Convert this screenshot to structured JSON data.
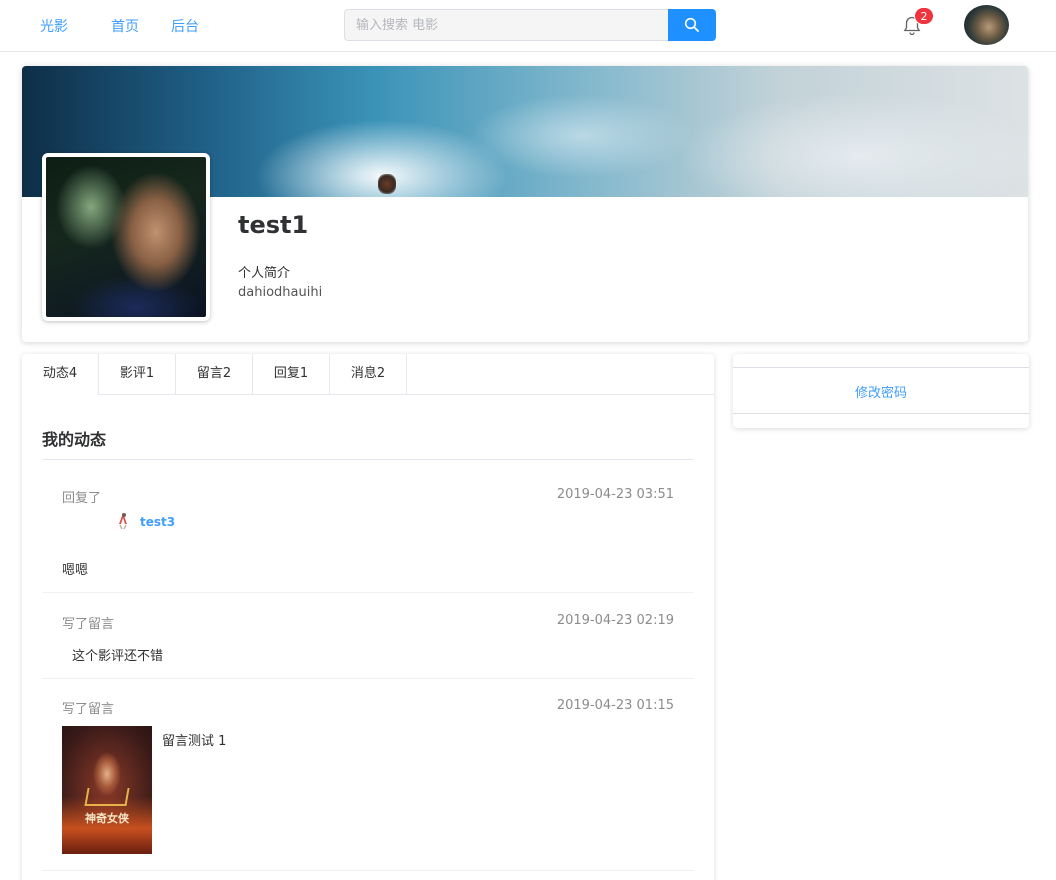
{
  "header": {
    "brand": "光影",
    "nav_home": "首页",
    "nav_admin": "后台",
    "search_placeholder": "输入搜索 电影",
    "notification_count": "2"
  },
  "profile": {
    "username": "test1",
    "bio_label": "个人简介",
    "bio": "dahiodhauihi"
  },
  "tabs": [
    {
      "label": "动态4"
    },
    {
      "label": "影评1"
    },
    {
      "label": "留言2"
    },
    {
      "label": "回复1"
    },
    {
      "label": "消息2"
    }
  ],
  "feed": {
    "title": "我的动态",
    "items": [
      {
        "kind": "回复了",
        "time": "2019-04-23 03:51",
        "target_user": "test3",
        "text": "嗯嗯"
      },
      {
        "kind": "写了留言",
        "time": "2019-04-23 02:19",
        "text": "这个影评还不错"
      },
      {
        "kind": "写了留言",
        "time": "2019-04-23 01:15",
        "text": "留言测试 1",
        "poster_title": "神奇女侠"
      }
    ]
  },
  "sidebar": {
    "change_password": "修改密码"
  },
  "colors": {
    "accent": "#409eff",
    "search_button": "#1e90ff",
    "badge": "#f0333f"
  }
}
